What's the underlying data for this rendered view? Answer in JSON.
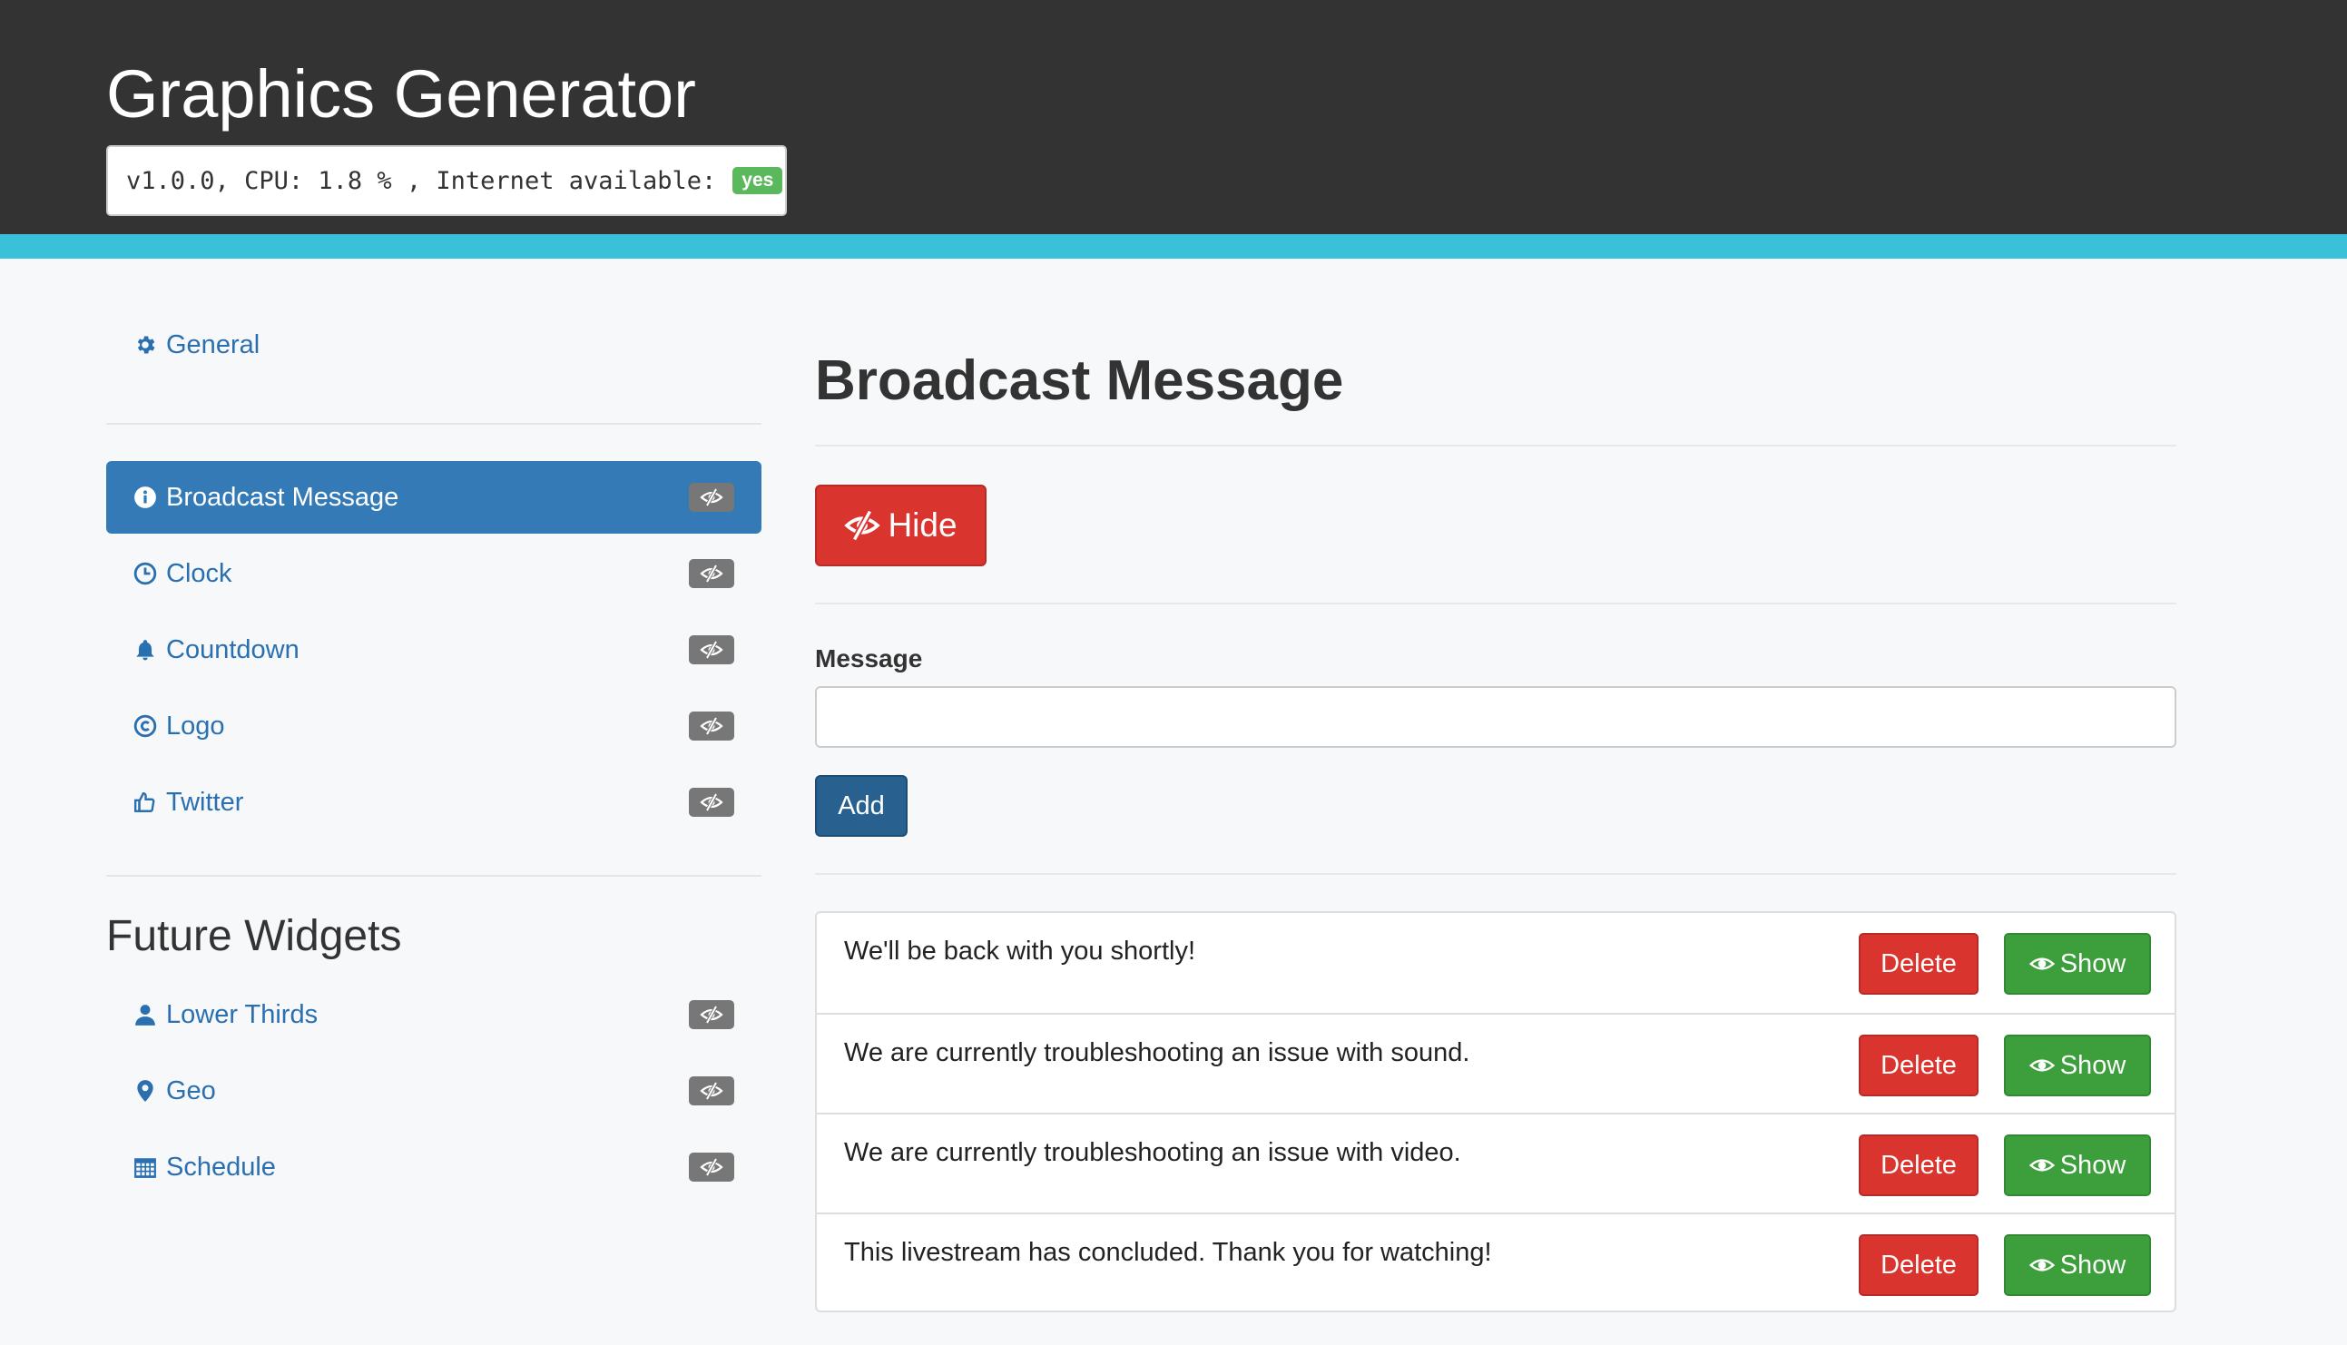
{
  "header": {
    "app_title": "Graphics Generator",
    "status": {
      "version": "v1.0.0,",
      "cpu": "CPU: 1.8 % ,",
      "internet_label": "Internet available:",
      "internet_badge": "yes"
    }
  },
  "sidebar": {
    "general": {
      "label": "General",
      "icon": "gear-icon"
    },
    "widgets": [
      {
        "label": "Broadcast Message",
        "icon": "info-circle-icon",
        "active": true
      },
      {
        "label": "Clock",
        "icon": "clock-icon",
        "active": false
      },
      {
        "label": "Countdown",
        "icon": "bell-icon",
        "active": false
      },
      {
        "label": "Logo",
        "icon": "copyright-circle-icon",
        "active": false
      },
      {
        "label": "Twitter",
        "icon": "thumbs-up-icon",
        "active": false
      }
    ],
    "future_heading": "Future Widgets",
    "future_widgets": [
      {
        "label": "Lower Thirds",
        "icon": "user-icon"
      },
      {
        "label": "Geo",
        "icon": "map-marker-icon"
      },
      {
        "label": "Schedule",
        "icon": "calendar-icon"
      }
    ]
  },
  "main": {
    "title": "Broadcast Message",
    "hide_button": "Hide",
    "message_label": "Message",
    "message_value": "",
    "add_button": "Add",
    "messages": [
      {
        "text": "We'll be back with you shortly!",
        "delete_label": "Delete",
        "show_label": "Show"
      },
      {
        "text": "We are currently troubleshooting an issue with sound.",
        "delete_label": "Delete",
        "show_label": "Show"
      },
      {
        "text": "We are currently troubleshooting an issue with video.",
        "delete_label": "Delete",
        "show_label": "Show"
      },
      {
        "text": "This livestream has concluded. Thank you for watching!",
        "delete_label": "Delete",
        "show_label": "Show"
      }
    ]
  },
  "colors": {
    "header_bg": "#333333",
    "accent_bar": "#38c1d8",
    "primary": "#337ab7",
    "danger": "#d9342e",
    "success": "#3c9f3c",
    "badge_success": "#5cb85c",
    "eye_badge": "#777777"
  }
}
